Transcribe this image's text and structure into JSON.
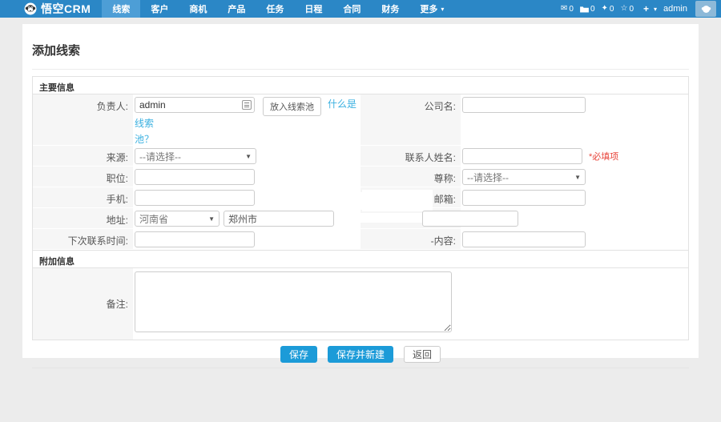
{
  "colors": {
    "brand_blue": "#2b87c6",
    "active_tab_blue": "#4d9ed6",
    "button_blue": "#1c9bd8",
    "link_blue": "#3ab0e0",
    "required_red": "#e8463c",
    "label_column_gray": "#f6f6f6"
  },
  "icons": {
    "mail": "✉",
    "diamond": "✦",
    "star": "☆",
    "plus": "+",
    "caret_down": "▾",
    "select_caret": "▼"
  },
  "nav": {
    "brand": "悟空CRM",
    "items": [
      "线索",
      "客户",
      "商机",
      "产品",
      "任务",
      "日程",
      "合同",
      "财务",
      "更多"
    ],
    "active_item": "线索",
    "counters": {
      "mail_count": "0",
      "folder_count": "0",
      "diamond_count": "0",
      "star_count": "0"
    },
    "username": "admin"
  },
  "page": {
    "title": "添加线索"
  },
  "form": {
    "section_main": "主要信息",
    "section_extra": "附加信息",
    "owner_label": "负责人:",
    "owner_value": "admin",
    "pool_button": "放入线索池",
    "pool_link_line1": "什么是线索",
    "pool_link_line2": "池？",
    "company_label": "公司名:",
    "source_label": "来源:",
    "source_value": "--请选择--",
    "contact_label": "联系人姓名:",
    "required_note": "*必填项",
    "position_label": "职位:",
    "salutation_label": "尊称:",
    "salutation_value": "--请选择--",
    "mobile_label": "手机:",
    "email_label": "邮箱:",
    "address_label": "地址:",
    "province_value": "河南省",
    "city_value": "郑州市",
    "next_time_label": "下次联系时间:",
    "next_content_label": "-内容:",
    "remark_label": "备注:",
    "buttons": {
      "save": "保存",
      "save_new": "保存并新建",
      "back": "返回"
    }
  }
}
